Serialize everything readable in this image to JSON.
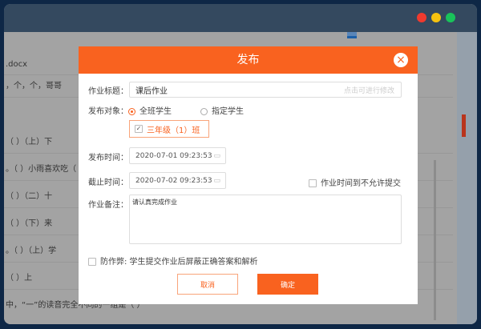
{
  "window": {
    "dots": {
      "red": "#f03a2e",
      "yellow": "#f5c20f",
      "green": "#19c35a"
    }
  },
  "background_rows": [
    ".docx",
    "，个，个，哥哥",
    "（ ）（上）下",
    "。（ ）小雨喜欢吃（",
    "（ ）（二）十",
    "（ ）（下）来",
    "。（ ）（上）学",
    "（ ）上",
    "中，“一”的读音完全不同的一组是（ ）"
  ],
  "dialog": {
    "title": "发布",
    "title_label": "作业标题：",
    "title_value": "课后作业",
    "title_hint": "点击可进行修改",
    "target_label": "发布对象：",
    "target_all": "全班学生",
    "target_specific": "指定学生",
    "class_name": "三年级（1）班",
    "publish_label": "发布时间：",
    "publish_value": "2020-07-01 09:23:53",
    "deadline_label": "截止时间：",
    "deadline_value": "2020-07-02 09:23:53",
    "no_late_label": "作业时间到不允许提交",
    "note_label": "作业备注：",
    "note_value": "请认真完成作业",
    "anticheat_label": "防作弊: 学生提交作业后屏蔽正确答案和解析",
    "cancel": "取消",
    "confirm": "确定"
  },
  "colors": {
    "accent": "#f9621f"
  }
}
